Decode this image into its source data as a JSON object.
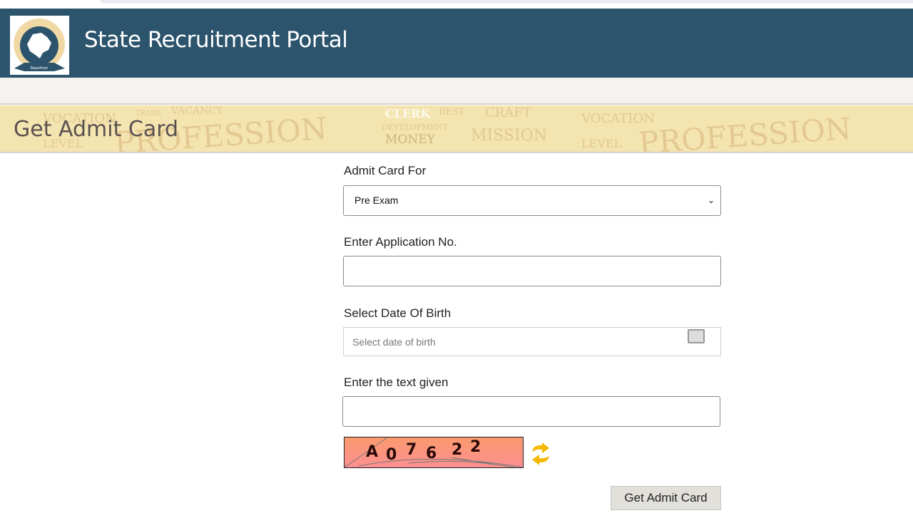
{
  "header": {
    "title": "State Recruitment Portal",
    "logo_text": [
      "State",
      "Recruitment",
      "Portal",
      "Rajasthan"
    ]
  },
  "banner": {
    "heading": "Get Admit Card",
    "background_words": [
      "VOCATION",
      "TRADE",
      "VACANCY",
      "PROFESSION",
      "LEVEL",
      "CLERK",
      "BEST",
      "DEVELOPMENT",
      "MONEY",
      "MISSION",
      "CRAFT",
      "VOCATION",
      "PROFESSION",
      "LEVEL"
    ]
  },
  "form": {
    "admit_card_for_label": "Admit Card For",
    "admit_card_for_value": "Pre Exam",
    "application_no_label": "Enter Application No.",
    "application_no_value": "",
    "dob_label": "Select Date Of Birth",
    "dob_placeholder": "Select date of birth",
    "captcha_label": "Enter the text given",
    "captcha_value": "",
    "captcha_chars": [
      "A",
      "0",
      "7",
      "6",
      "2",
      "2"
    ],
    "submit_label": "Get Admit Card"
  },
  "colors": {
    "header": "#2c546d",
    "banner": "#f3e4b0",
    "captcha": "#fb9a6e",
    "refresh": "#f5b800"
  }
}
